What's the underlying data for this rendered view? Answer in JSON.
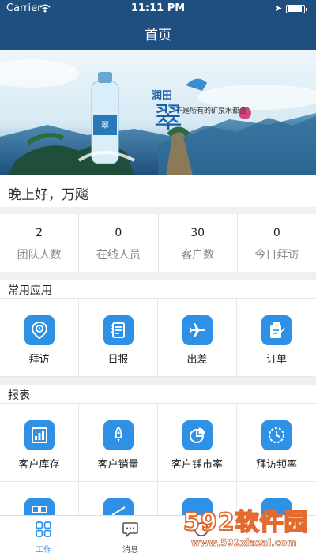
{
  "status_bar": {
    "carrier": "Carrier",
    "time": "11:11 PM",
    "battery_level": 0.9
  },
  "nav": {
    "title": "首页"
  },
  "banner": {
    "slogan": "不是所有的矿泉水都含"
  },
  "greeting": "晚上好，万飚",
  "stats": [
    {
      "value": "2",
      "label": "团队人数"
    },
    {
      "value": "0",
      "label": "在线人员"
    },
    {
      "value": "30",
      "label": "客户数"
    },
    {
      "value": "0",
      "label": "今日拜访"
    }
  ],
  "common_apps": {
    "title": "常用应用",
    "items": [
      {
        "label": "拜访",
        "icon": "location-pin-icon"
      },
      {
        "label": "日报",
        "icon": "report-icon"
      },
      {
        "label": "出差",
        "icon": "airplane-icon"
      },
      {
        "label": "订单",
        "icon": "order-icon"
      }
    ]
  },
  "reports": {
    "title": "报表",
    "items": [
      {
        "label": "客户库存",
        "icon": "inventory-icon"
      },
      {
        "label": "客户销量",
        "icon": "rocket-icon"
      },
      {
        "label": "客户铺市率",
        "icon": "pie-chart-icon"
      },
      {
        "label": "拜访频率",
        "icon": "clock-dashed-icon"
      }
    ]
  },
  "tabbar": {
    "items": [
      {
        "label": "工作",
        "icon": "grid-icon",
        "active": true
      },
      {
        "label": "消息",
        "icon": "message-icon",
        "active": false
      },
      {
        "label": "",
        "icon": "more-icon",
        "active": false
      }
    ]
  },
  "watermark": {
    "big": "592软件园",
    "small": "www.592xiazai.com"
  },
  "colors": {
    "nav": "#1f4f80",
    "accent": "#2e91e6"
  }
}
